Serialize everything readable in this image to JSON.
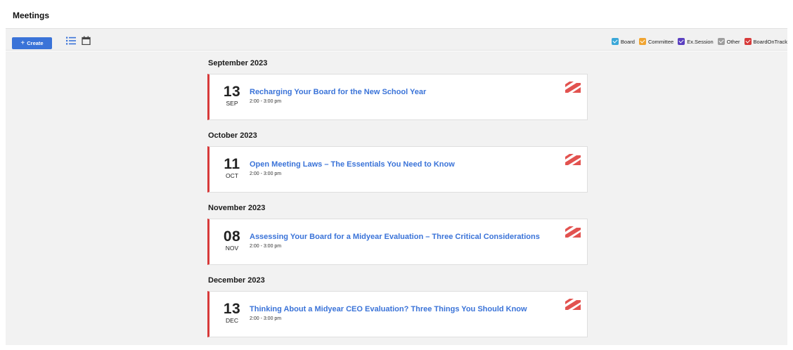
{
  "page": {
    "title": "Meetings"
  },
  "toolbar": {
    "create_label": "Create",
    "create_icon": "plus-icon",
    "list_view_icon": "list-view-icon",
    "calendar_view_icon": "calendar-icon"
  },
  "legend": [
    {
      "label": "Board",
      "color": "#3aa7d8"
    },
    {
      "label": "Committee",
      "color": "#f0a431"
    },
    {
      "label": "Ex.Session",
      "color": "#5a3fc0"
    },
    {
      "label": "Other",
      "color": "#9e9e9e"
    },
    {
      "label": "BoardOnTrack",
      "color": "#d73a3a"
    }
  ],
  "groups": [
    {
      "month": "September 2023",
      "meeting": {
        "day": "13",
        "mon": "SEP",
        "title": "Recharging Your Board for the New School Year",
        "time": "2:00 - 3:00 pm"
      }
    },
    {
      "month": "October 2023",
      "meeting": {
        "day": "11",
        "mon": "OCT",
        "title": "Open Meeting Laws – The Essentials You Need to Know",
        "time": "2:00 - 3:00 pm"
      }
    },
    {
      "month": "November 2023",
      "meeting": {
        "day": "08",
        "mon": "NOV",
        "title": "Assessing Your Board for a Midyear Evaluation – Three Critical Considerations",
        "time": "2:00 - 3:00 pm"
      }
    },
    {
      "month": "December 2023",
      "meeting": {
        "day": "13",
        "mon": "DEC",
        "title": "Thinking About a Midyear CEO Evaluation? Three Things You Should Know",
        "time": "2:00 - 3:00 pm"
      }
    }
  ],
  "colors": {
    "accent": "#3a73d8",
    "card_border": "#d73a3a",
    "background": "#f2f2f2"
  }
}
